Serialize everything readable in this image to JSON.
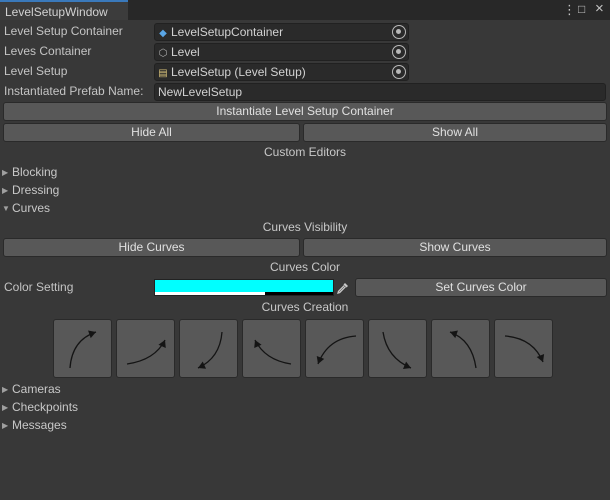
{
  "window": {
    "tab_title": "LevelSetupWindow",
    "menu_glyph": "⋮",
    "maximize_glyph": "□",
    "close_glyph": "×"
  },
  "fields": {
    "level_setup_container": {
      "label": "Level Setup Container",
      "value": "LevelSetupContainer",
      "icon": "prefab-icon"
    },
    "levels_container": {
      "label": "Leves Container",
      "value": "Level",
      "icon": "gameobject-icon"
    },
    "level_setup": {
      "label": "Level Setup",
      "value": "LevelSetup (Level Setup)",
      "icon": "script-icon"
    },
    "prefab_name": {
      "label": "Instantiated Prefab Name:",
      "value": "NewLevelSetup"
    }
  },
  "buttons": {
    "instantiate": "Instantiate Level Setup Container",
    "hide_all": "Hide All",
    "show_all": "Show All",
    "hide_curves": "Hide Curves",
    "show_curves": "Show Curves",
    "set_curves_color": "Set Curves Color"
  },
  "headers": {
    "custom_editors": "Custom Editors",
    "curves_visibility": "Curves Visibility",
    "curves_color": "Curves Color",
    "curves_creation": "Curves Creation"
  },
  "foldouts": {
    "blocking": "Blocking",
    "dressing": "Dressing",
    "curves": "Curves",
    "cameras": "Cameras",
    "checkpoints": "Checkpoints",
    "messages": "Messages"
  },
  "color_setting": {
    "label": "Color Setting",
    "color": "#00ffff",
    "alpha": 0.62
  },
  "curve_buttons": [
    "curve-up-right-icon",
    "curve-right-up-icon",
    "curve-down-left-icon",
    "curve-left-up-icon",
    "curve-left-down-icon",
    "curve-down-right-icon",
    "curve-up-left-icon",
    "curve-right-down-icon"
  ],
  "colors": {
    "background": "#383838",
    "button": "#585858",
    "field": "#2a2a2a",
    "accent": "#3a79bb"
  }
}
